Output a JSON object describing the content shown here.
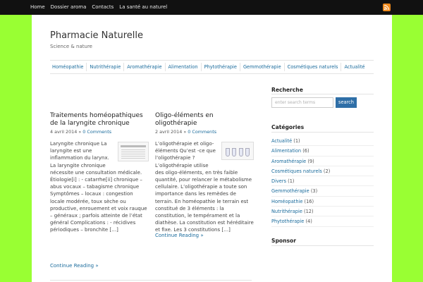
{
  "topbar": {
    "items": [
      "Home",
      "Dossier aroma",
      "Contacts",
      "La santé au naturel"
    ],
    "rss_icon": "rss-icon"
  },
  "site": {
    "title": "Pharmacie Naturelle",
    "description": "Science & nature"
  },
  "nav": {
    "items": [
      "Homéopathie",
      "Nutrithérapie",
      "Aromathérapie",
      "Alimentation",
      "Phytothérapie",
      "Gemmothérapie",
      "Cosmétiques naturels",
      "Actualité"
    ]
  },
  "posts": [
    {
      "title": "Traitements homéopathiques de la laryngite chronique",
      "date": "4 avril 2014",
      "separator": "»",
      "comments": "0 Comments",
      "excerpt": "Laryngite chronique La laryngite est une inflammation du larynx. La laryngite chronique nécessite une consultation médicale. Étiologie[i] : - catarrhe[ii] chronique – abus vocaux – tabagisme chronique Symptômes – locaux : congestion locale modérée, toux sèche ou productive, enrouement et voix rauque – généraux ; parfois atteinte de l’état général Complications : - récidives périodiques – bronchite […]",
      "more": "Continue Reading »"
    },
    {
      "title": "Oligo-éléments en oligothérapie",
      "date": "2 avril 2014",
      "separator": "»",
      "comments": "0 Comments",
      "excerpt": "L’oligothérapie et oligo-éléments Qu’est -ce que l’oligothérapie ? L’oligothérapie utilise des oligo-éléments, en très faible quantité, pour relancer le métabolisme cellulaire. L’oligothérapie a toute son importance dans les remèdes de terrain. En homéopathie le terrain est constitué de 3 éléments : la constitution, le tempérament et la diathèse. La constitution est héréditaire et fixe. Les 3 constitutions […]",
      "more": "Continue Reading »"
    }
  ],
  "sidebar": {
    "search_title": "Recherche",
    "search_placeholder": "enter search terms",
    "search_button": "search",
    "categories_title": "Catégories",
    "categories": [
      {
        "name": "Actualité",
        "count": "(1)"
      },
      {
        "name": "Alimentation",
        "count": "(6)"
      },
      {
        "name": "Aromathérapie",
        "count": "(9)"
      },
      {
        "name": "Cosmétiques naturels",
        "count": "(2)"
      },
      {
        "name": "Divers",
        "count": "(1)"
      },
      {
        "name": "Gemmothérapie",
        "count": "(3)"
      },
      {
        "name": "Homéopathie",
        "count": "(16)"
      },
      {
        "name": "Nutrithérapie",
        "count": "(12)"
      },
      {
        "name": "Phytothérapie",
        "count": "(4)"
      }
    ],
    "sponsor_title": "Sponsor"
  },
  "colors": {
    "background": "#99ff33",
    "topbar": "#111111",
    "link": "#1a6b9c",
    "button": "#2f6fa7",
    "rss": "#f08a1c"
  }
}
